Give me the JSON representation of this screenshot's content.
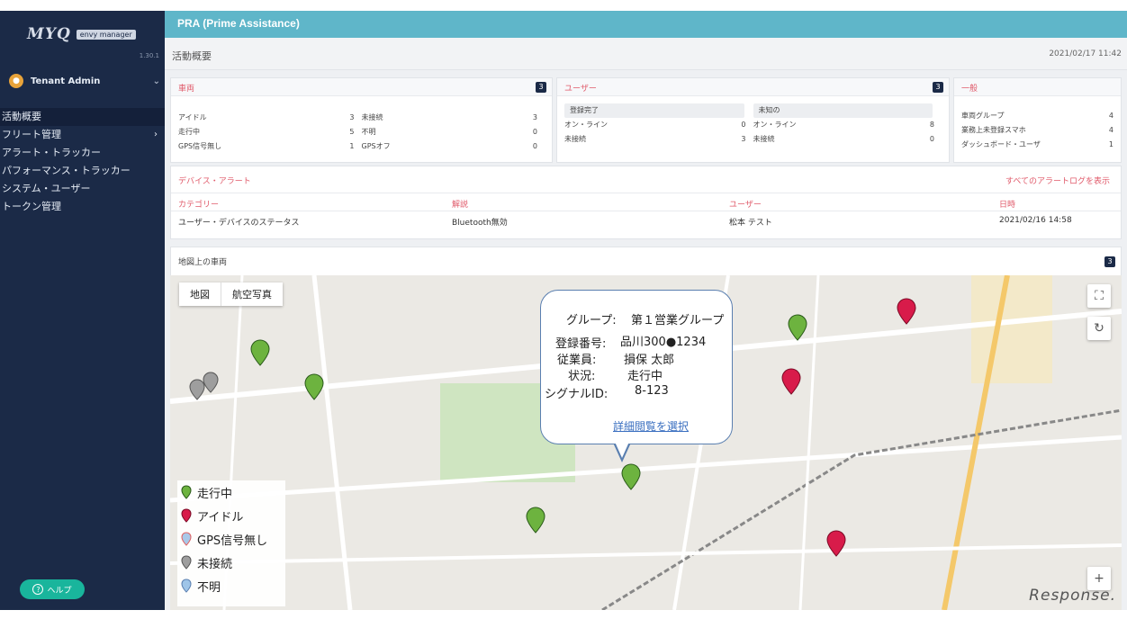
{
  "sidebar": {
    "logo_text": "MYQ",
    "logo_sub": "envy manager",
    "version": "1.30.1",
    "user_name": "Tenant Admin",
    "menu": [
      {
        "label": "活動概要",
        "active": true,
        "has_arrow": false
      },
      {
        "label": "フリート管理",
        "active": false,
        "has_arrow": true
      },
      {
        "label": "アラート・トラッカー",
        "active": false,
        "has_arrow": false
      },
      {
        "label": "パフォーマンス・トラッカー",
        "active": false,
        "has_arrow": false
      },
      {
        "label": "システム・ユーザー",
        "active": false,
        "has_arrow": false
      },
      {
        "label": "トークン管理",
        "active": false,
        "has_arrow": false
      }
    ],
    "help_label": "ヘルプ",
    "help_icon": "question-circle-icon"
  },
  "header": {
    "app_title": "PRA (Prime Assistance)",
    "page_title": "活動概要",
    "timestamp": "2021/02/17 11:42"
  },
  "vehicles_panel": {
    "title": "車両",
    "badge": "3",
    "rows": [
      {
        "l1": "アイドル",
        "v1": "3",
        "l2": "未接続",
        "v2": "3"
      },
      {
        "l1": "走行中",
        "v1": "5",
        "l2": "不明",
        "v2": "0"
      },
      {
        "l1": "GPS信号無し",
        "v1": "1",
        "l2": "GPSオフ",
        "v2": "0"
      }
    ]
  },
  "users_panel": {
    "title": "ユーザー",
    "badge": "3",
    "col1_head": "登録完了",
    "col2_head": "未知の",
    "rows": [
      {
        "l1": "オン・ライン",
        "v1": "0",
        "l2": "オン・ライン",
        "v2": "8"
      },
      {
        "l1": "未接続",
        "v1": "3",
        "l2": "未接続",
        "v2": "0"
      }
    ]
  },
  "general_panel": {
    "title": "一般",
    "rows": [
      {
        "label": "車両グループ",
        "value": "4"
      },
      {
        "label": "業務上未登録スマホ",
        "value": "4"
      },
      {
        "label": "ダッシュボード・ユーザ",
        "value": "1"
      }
    ]
  },
  "alerts_panel": {
    "title": "デバイス・アラート",
    "view_all": "すべてのアラートログを表示",
    "columns": {
      "category": "カテゴリー",
      "description": "解説",
      "user": "ユーザー",
      "date": "日時"
    },
    "rows": [
      {
        "category": "ユーザー・デバイスのステータス",
        "description": "Bluetooth無効",
        "user": "松本 テスト",
        "date": "2021/02/16 14:58"
      }
    ]
  },
  "map_panel": {
    "title": "地図上の車両",
    "badge": "3",
    "map_type_buttons": [
      "地図",
      "航空写真"
    ],
    "popup": {
      "group_label": "グループ:",
      "group_value": "第１営業グループ",
      "reg_label": "登録番号:",
      "reg_value": "品川300●1234",
      "emp_label": "従業員:",
      "emp_value": "損保 太郎",
      "status_label": "状況:",
      "status_value": "走行中",
      "signal_label": "シグナルID:",
      "signal_value": "8-123",
      "detail_link": "詳細閲覧を選択"
    },
    "legend": [
      {
        "label": "走行中",
        "color": "#6db33f"
      },
      {
        "label": "アイドル",
        "color": "#d81b4a"
      },
      {
        "label": "GPS信号無し",
        "color": "#a8c8e8"
      },
      {
        "label": "未接続",
        "color": "#9e9e9e"
      },
      {
        "label": "不明",
        "color": "#9fc5e8"
      }
    ]
  },
  "watermark": "Response."
}
